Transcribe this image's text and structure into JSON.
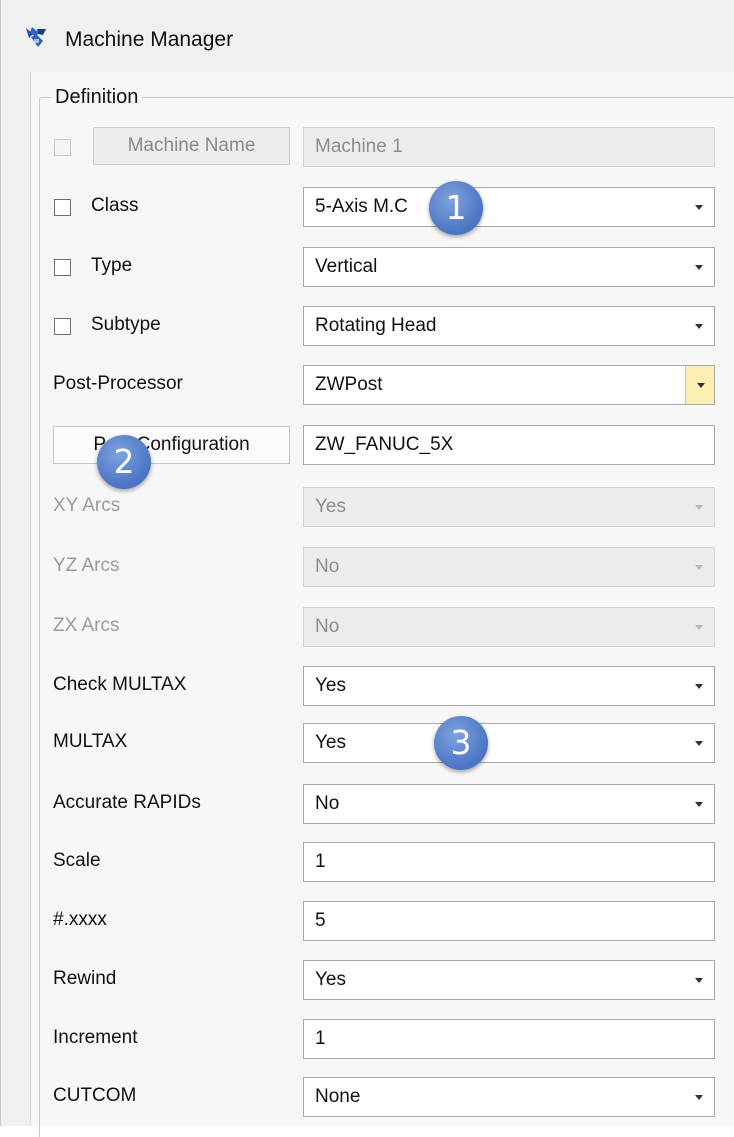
{
  "window": {
    "title": "Machine Manager",
    "icon": "machine-manager-app-icon"
  },
  "group": {
    "label": "Definition"
  },
  "rows": {
    "machine_name": {
      "button": "Machine Name",
      "value": "Machine 1"
    },
    "class": {
      "label": "Class",
      "value": "5-Axis M.C"
    },
    "type": {
      "label": "Type",
      "value": "Vertical"
    },
    "subtype": {
      "label": "Subtype",
      "value": "Rotating Head"
    },
    "post_processor": {
      "label": "Post-Processor",
      "value": "ZWPost"
    },
    "post_configuration": {
      "button": "Post Configuration",
      "value": "ZW_FANUC_5X"
    },
    "xy_arcs": {
      "label": "XY Arcs",
      "value": "Yes"
    },
    "yz_arcs": {
      "label": "YZ Arcs",
      "value": "No"
    },
    "zx_arcs": {
      "label": "ZX Arcs",
      "value": "No"
    },
    "check_multax": {
      "label": "Check MULTAX",
      "value": "Yes"
    },
    "multax": {
      "label": "MULTAX",
      "value": "Yes"
    },
    "accurate_rapids": {
      "label": "Accurate RAPIDs",
      "value": "No"
    },
    "scale": {
      "label": "Scale",
      "value": "1"
    },
    "decimals": {
      "label": "#.xxxx",
      "value": "5"
    },
    "rewind": {
      "label": "Rewind",
      "value": "Yes"
    },
    "increment": {
      "label": "Increment",
      "value": "1"
    },
    "cutcom": {
      "label": "CUTCOM",
      "value": "None"
    }
  },
  "callouts": {
    "one": "1",
    "two": "2",
    "three": "3"
  },
  "colors": {
    "callout": "#4a74c4",
    "highlight_arrow": "#fdeeb4"
  }
}
